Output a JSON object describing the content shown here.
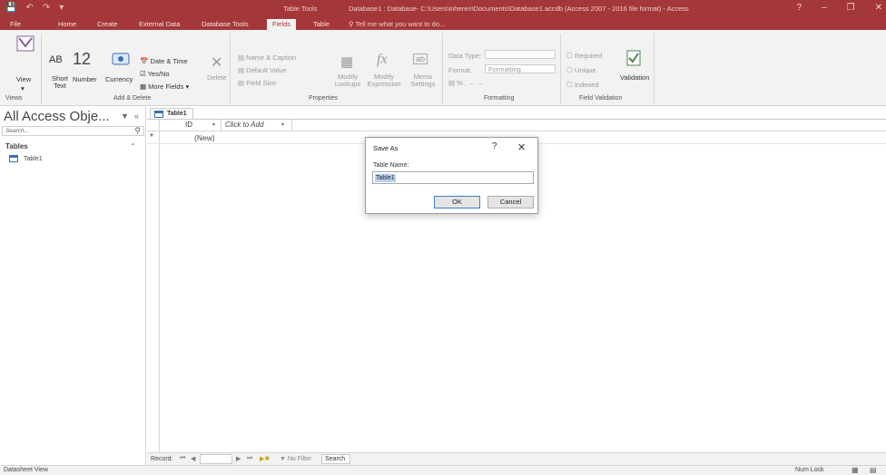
{
  "app": {
    "context_tab_label": "Table Tools",
    "window_title": "Database1 : Database- C:\\Users\\inheren\\Documents\\Database1.accdb (Access 2007 - 2016 file format) - Access",
    "help_glyph": "?"
  },
  "ribbon_tabs": [
    "File",
    "Home",
    "Create",
    "External Data",
    "Database Tools",
    "Fields",
    "Table"
  ],
  "active_tab": "Fields",
  "tell_me": "Tell me what you want to do...",
  "ribbon": {
    "views": {
      "view_label": "View",
      "group_label": "Views"
    },
    "add_delete": {
      "short_text_icon": "AB",
      "short_text_label": "Short Text",
      "number_icon": "12",
      "number_label": "Number",
      "currency_label": "Currency",
      "date_time": "Date & Time",
      "yes_no": "Yes/No",
      "more_fields": "More Fields",
      "delete_label": "Delete",
      "group_label": "Add & Delete"
    },
    "properties": {
      "name_caption": "Name & Caption",
      "default_value": "Default Value",
      "field_size": "Field Size",
      "modify_lookups": "Modify Lookups",
      "modify_expression": "Modify Expression",
      "memo_settings": "Memo Settings",
      "group_label": "Properties"
    },
    "formatting": {
      "data_type_label": "Data Type:",
      "format_label": "Format:",
      "format_value": "Formatting",
      "group_label": "Formatting"
    },
    "field_validation": {
      "required": "Required",
      "unique": "Unique",
      "indexed": "Indexed",
      "validation": "Validation",
      "group_label": "Field Validation"
    }
  },
  "nav_pane": {
    "title": "All Access Obje...",
    "search_placeholder": "Search...",
    "group": "Tables",
    "items": [
      {
        "label": "Table1",
        "icon": "table-icon"
      }
    ]
  },
  "document": {
    "tab_label": "Table1",
    "columns": [
      "ID",
      "Click to Add"
    ],
    "new_row_marker": "*",
    "new_row_value": "(New)"
  },
  "record_nav": {
    "label": "Record:",
    "no_filter": "No Filter",
    "search": "Search"
  },
  "status": {
    "left": "Datasheet View",
    "right": "Num Lock"
  },
  "dialog": {
    "title": "Save As",
    "help": "?",
    "close": "✕",
    "field_label": "Table Name:",
    "field_value": "Table1",
    "ok": "OK",
    "cancel": "Cancel"
  },
  "colors": {
    "access_red": "#a4373a",
    "ribbon_bg": "#f2f2f2",
    "selection_blue": "#b8d2f1",
    "default_button_border": "#3c7fd0"
  }
}
